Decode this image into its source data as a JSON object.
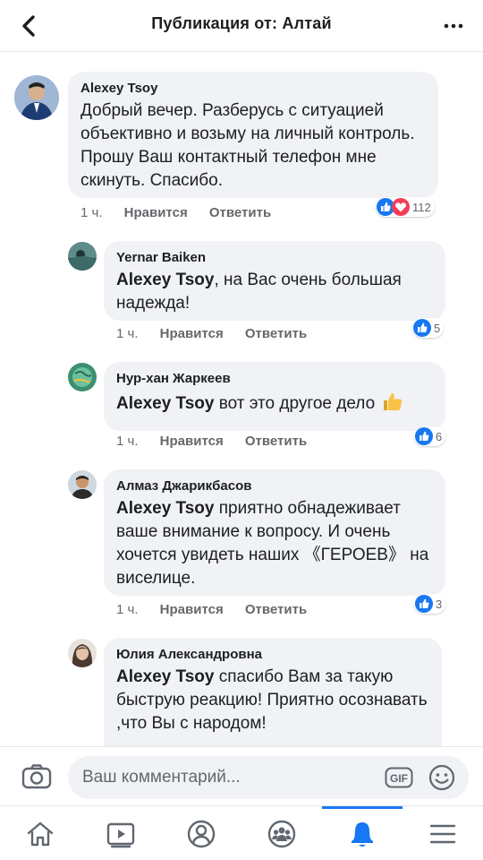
{
  "header": {
    "title": "Публикация от: Алтай"
  },
  "comments": [
    {
      "author": "Alexey Tsoy",
      "mention": "",
      "text": "Добрый вечер. Разберусь с ситуацией объективно и возьму на личный контроль. Прошу Ваш контактный телефон мне скинуть. Спасибо.",
      "time": "1 ч.",
      "like": "Нравится",
      "reply": "Ответить",
      "reactions": "112"
    },
    {
      "author": "Yernar Baiken",
      "mention": "Alexey Tsoy",
      "text": ",  на Вас очень большая надежда!",
      "time": "1 ч.",
      "like": "Нравится",
      "reply": "Ответить",
      "reactions": "5"
    },
    {
      "author": "Нур-хан Жаркеев",
      "mention": "Alexey Tsoy",
      "text": " вот это другое дело",
      "time": "1 ч.",
      "like": "Нравится",
      "reply": "Ответить",
      "reactions": "6"
    },
    {
      "author": "Алмаз Джарикбасов",
      "mention": "Alexey Tsoy",
      "text": " приятно обнадеживает ваше внимание к вопросу.  И очень хочется увидеть наших 《ГЕРОЕВ》 на виселице.",
      "time": "1 ч.",
      "like": "Нравится",
      "reply": "Ответить",
      "reactions": "3"
    },
    {
      "author": "Юлия Александровна",
      "mention": "Alexey Tsoy",
      "text": "  спасибо Вам за такую быструю реакцию! Приятно осознавать ,что Вы с народом!",
      "time": "",
      "like": "",
      "reply": "",
      "reactions": ""
    }
  ],
  "composer": {
    "placeholder": "Ваш комментарий...",
    "gif_label": "GIF"
  },
  "tabs": [
    "home-icon",
    "video-icon",
    "profile-icon",
    "groups-icon",
    "notifications-icon",
    "menu-icon"
  ],
  "colors": {
    "accent": "#1877f2",
    "bubble": "#f0f2f5",
    "like_blue": "#1877f2",
    "love_red": "#f33e58",
    "meta_gray": "#65676b"
  }
}
